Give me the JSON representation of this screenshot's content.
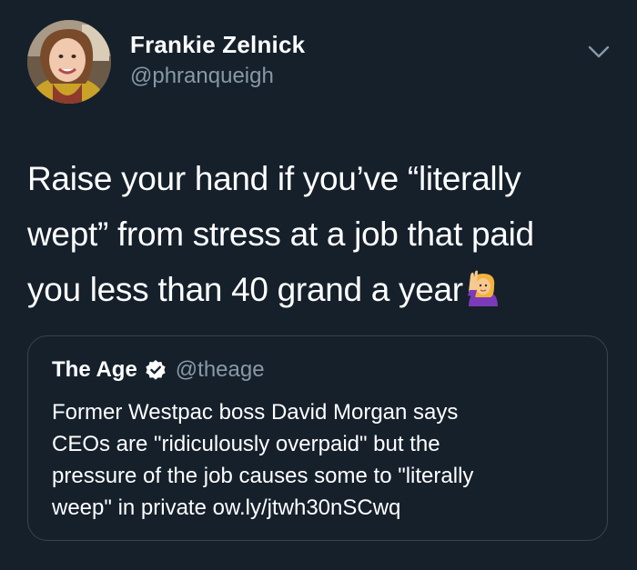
{
  "author": {
    "name": "Frankie Zelnick",
    "handle": "@phranqueigh",
    "avatar_icon": "profile-photo"
  },
  "menu_icon": "chevron-down-icon",
  "tweet": {
    "lines": [
      "Raise your hand if you’ve “literally",
      "wept” from stress at a job that paid",
      "you less than 40 grand a year"
    ],
    "emoji": "person-raising-hand-emoji"
  },
  "quoted_tweet": {
    "name": "The Age",
    "verified": true,
    "handle": "@theage",
    "lines": [
      "Former Westpac boss David Morgan says",
      "CEOs are \"ridiculously overpaid\" but the",
      "pressure of the job causes some to \"literally",
      "weep\" in private ow.ly/jtwh30nSCwq"
    ]
  },
  "colors": {
    "background": "#15202b",
    "text": "#ffffff",
    "secondary_text": "#8899a6",
    "border": "#38444d"
  }
}
